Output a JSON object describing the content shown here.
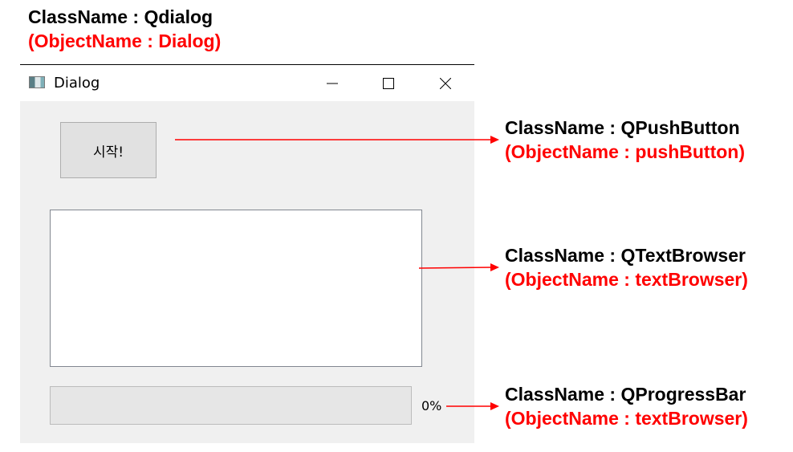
{
  "annotations": {
    "dialog": {
      "class_name": "ClassName : Qdialog",
      "object_name": "(ObjectName : Dialog)"
    },
    "push_button": {
      "class_name": "ClassName : QPushButton",
      "object_name": "(ObjectName : pushButton)"
    },
    "text_browser": {
      "class_name": "ClassName : QTextBrowser",
      "object_name": "(ObjectName : textBrowser)"
    },
    "progress_bar": {
      "class_name": "ClassName : QProgressBar",
      "object_name": "(ObjectName : textBrowser)"
    }
  },
  "window": {
    "title": "Dialog",
    "icon": "app-window-icon",
    "controls": [
      "minimize-icon",
      "maximize-icon",
      "close-icon"
    ]
  },
  "push_button": {
    "label": "시작!"
  },
  "text_browser": {
    "content": ""
  },
  "progress_bar": {
    "value": 0,
    "text": "0%"
  },
  "colors": {
    "annotation_class": "#000000",
    "annotation_object": "#ff0000",
    "arrow": "#ff0000",
    "dialog_bg": "#f0f0f0"
  }
}
